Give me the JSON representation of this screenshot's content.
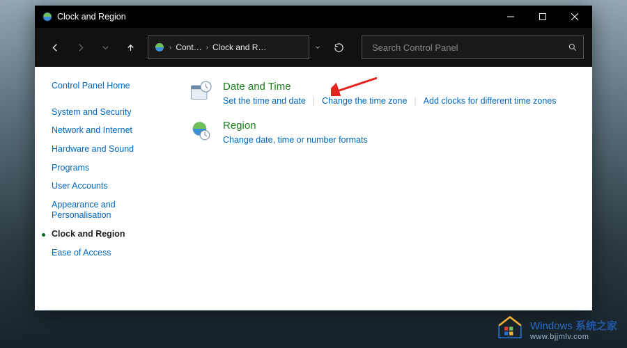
{
  "window": {
    "title": "Clock and Region"
  },
  "nav": {
    "breadcrumb": [
      "Cont…",
      "Clock and R…"
    ],
    "search_placeholder": "Search Control Panel"
  },
  "sidebar": {
    "home": "Control Panel Home",
    "items": [
      {
        "label": "System and Security",
        "current": false
      },
      {
        "label": "Network and Internet",
        "current": false
      },
      {
        "label": "Hardware and Sound",
        "current": false
      },
      {
        "label": "Programs",
        "current": false
      },
      {
        "label": "User Accounts",
        "current": false
      },
      {
        "label": "Appearance and Personalisation",
        "current": false
      },
      {
        "label": "Clock and Region",
        "current": true
      },
      {
        "label": "Ease of Access",
        "current": false
      }
    ]
  },
  "main": {
    "categories": [
      {
        "title": "Date and Time",
        "links": [
          "Set the time and date",
          "Change the time zone",
          "Add clocks for different time zones"
        ]
      },
      {
        "title": "Region",
        "links": [
          "Change date, time or number formats"
        ]
      }
    ]
  },
  "watermark": {
    "line1_prefix": "Windows",
    "line1_suffix": "系统之家",
    "line2": "www.bjjmlv.com"
  }
}
